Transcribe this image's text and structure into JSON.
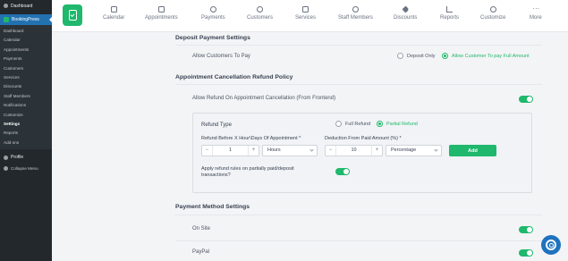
{
  "wp_sidebar": {
    "dashboard": "Dashboard",
    "plugin": "BookingPress",
    "submenu": [
      "Dashboard",
      "Calendar",
      "Appointments",
      "Payments",
      "Customers",
      "Services",
      "Discounts",
      "Staff Members",
      "Notifications",
      "Customize",
      "Settings",
      "Reports",
      "Add-ons"
    ],
    "current": "Settings",
    "profile": "Profile",
    "collapse": "Collapse Menu"
  },
  "nav": {
    "items": [
      "Calendar",
      "Appointments",
      "Payments",
      "Customers",
      "Services",
      "Staff Members",
      "Discounts",
      "Reports",
      "Customize",
      "More"
    ]
  },
  "deposit": {
    "title": "Deposit Payment Settings",
    "allow_label": "Allow Customers To Pay",
    "option_deposit": "Deposit Only",
    "option_full": "Allow Customer To pay Full Amount",
    "selected": "Allow Customer To pay Full Amount"
  },
  "cancellation": {
    "title": "Appointment Cancellation Refund Policy",
    "allow_refund_label": "Allow Refund On Appointment Cancellation (From Frontend)",
    "allow_refund_on": true,
    "refund_type_label": "Refund Type",
    "option_full": "Full Refund",
    "option_partial": "Partial Refund",
    "selected": "Partial Refund",
    "before_label": "Refund Before X Hour\\Days Of Appointment *",
    "before_value": "1",
    "unit_value": "Hours",
    "deduction_label": "Deduction From Paid Amount (%) *",
    "deduction_value": "10",
    "deduction_type": "Percentage",
    "add_button": "Add",
    "apply_partial_label": "Apply refund rules on partially paid/deposit transactions?",
    "apply_partial_on": true
  },
  "payment_methods": {
    "title": "Payment Method Settings",
    "on_site": "On Site",
    "on_site_on": true,
    "paypal": "PayPal",
    "paypal_on": true
  },
  "colors": {
    "brand": "#1fb86c",
    "wp_sidebar": "#23282d",
    "wp_active": "#2271b1"
  }
}
